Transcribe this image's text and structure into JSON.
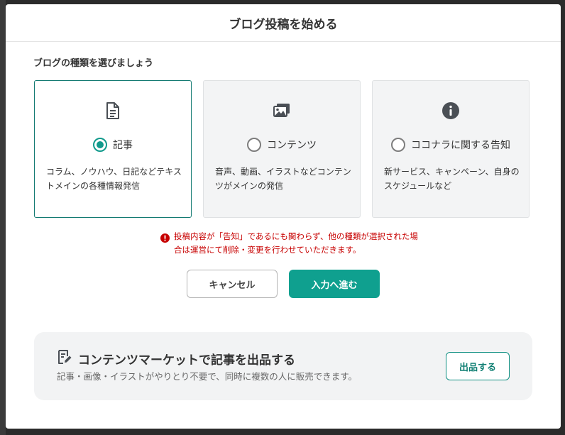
{
  "modal": {
    "title": "ブログ投稿を始める",
    "section_label": "ブログの種類を選びましょう"
  },
  "blog_types": [
    {
      "icon": "document-icon",
      "label": "記事",
      "description": "コラム、ノウハウ、日記などテキストメインの各種情報発信",
      "selected": true
    },
    {
      "icon": "media-gallery-icon",
      "label": "コンテンツ",
      "description": "音声、動画、イラストなどコンテンツがメインの発信",
      "selected": false
    },
    {
      "icon": "info-icon",
      "label": "ココナラに関する告知",
      "description": "新サービス、キャンペーン、自身のスケジュールなど",
      "selected": false
    }
  ],
  "warning": {
    "icon": "alert-icon",
    "text": "投稿内容が「告知」であるにも関わらず、他の種類が選択された場合は運営にて削除・変更を行わせていただきます。"
  },
  "buttons": {
    "cancel": "キャンセル",
    "next": "入力へ進む"
  },
  "promo": {
    "icon": "edit-document-icon",
    "title": "コンテンツマーケットで記事を出品する",
    "subtitle": "記事・画像・イラストがやりとり不要で、同時に複数の人に販売できます。",
    "button": "出品する"
  },
  "colors": {
    "accent": "#0fa08f",
    "selected_border": "#137a72",
    "warning": "#c70000",
    "card_bg": "#f3f4f5"
  }
}
